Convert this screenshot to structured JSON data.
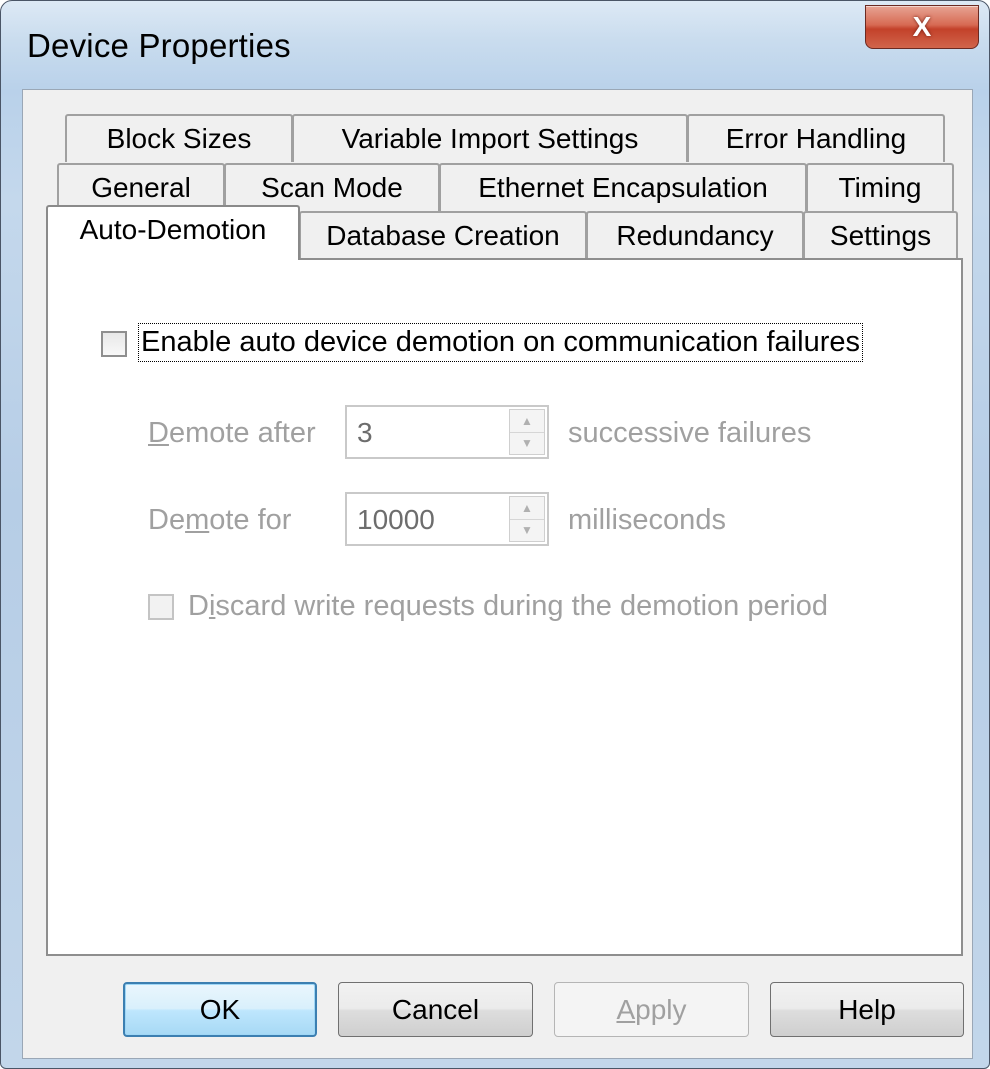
{
  "window": {
    "title": "Device Properties",
    "close_glyph": "X"
  },
  "tabs": {
    "row1": [
      "Block Sizes",
      "Variable Import Settings",
      "Error Handling"
    ],
    "row2": [
      "General",
      "Scan Mode",
      "Ethernet Encapsulation",
      "Timing"
    ],
    "row3": [
      "Auto-Demotion",
      "Database Creation",
      "Redundancy",
      "Settings"
    ],
    "active": "Auto-Demotion"
  },
  "auto_demotion": {
    "enable_label": "Enable auto device demotion on communication failures",
    "enable_checked": false,
    "demote_after": {
      "label_pre": "",
      "label_ul": "D",
      "label_post": "emote after",
      "value": "3",
      "unit": "successive failures"
    },
    "demote_for": {
      "label_pre": "De",
      "label_ul": "m",
      "label_post": "ote for",
      "value": "10000",
      "unit": "milliseconds"
    },
    "discard": {
      "label_pre": "D",
      "label_ul": "i",
      "label_post": "scard write requests during the demotion period",
      "checked": false
    }
  },
  "buttons": {
    "ok": "OK",
    "cancel": "Cancel",
    "apply_ul": "A",
    "apply_rest": "pply",
    "help": "Help"
  },
  "colors": {
    "frame": "#c2d6ea",
    "dialog_bg": "#f0f0f0",
    "disabled_text": "#a0a0a0",
    "default_button_border": "#3c7fb1",
    "close_button": "#c3412a"
  },
  "icons": {
    "close": "close-icon",
    "spin_up": "spin-up-arrow-icon",
    "spin_down": "spin-down-arrow-icon"
  }
}
